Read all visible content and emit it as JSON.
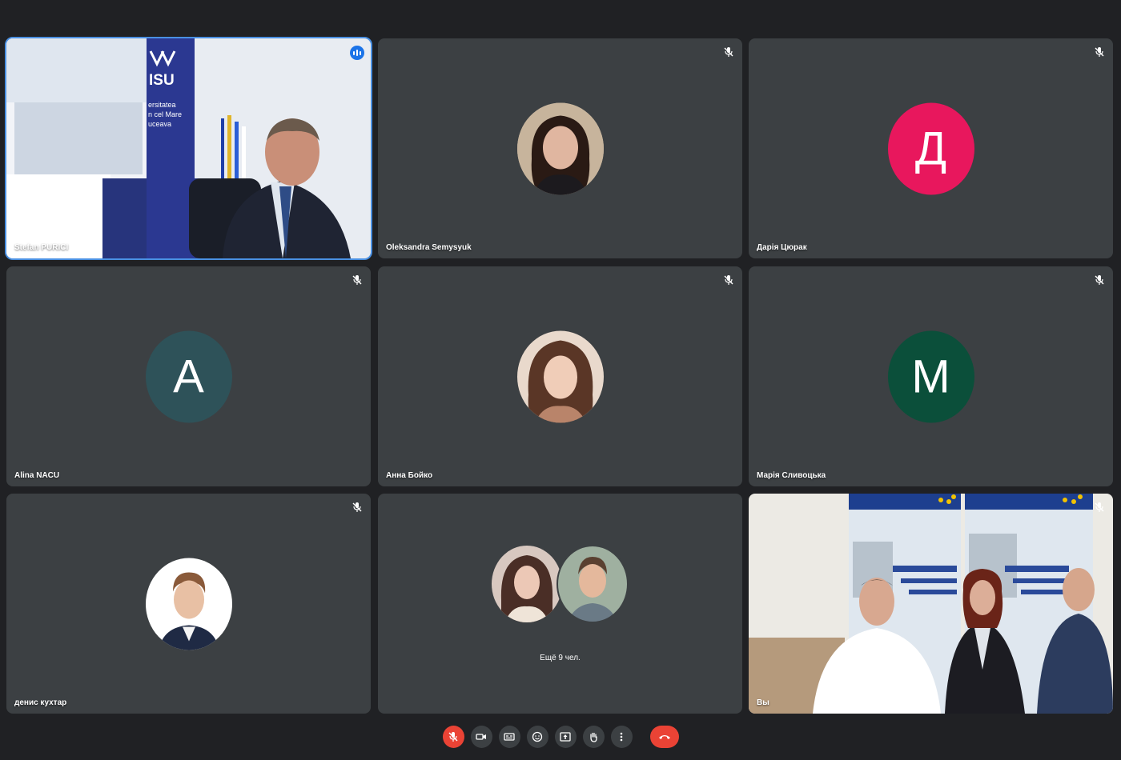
{
  "participants": [
    {
      "name": "Stefan PURICI",
      "kind": "video",
      "speaking": true
    },
    {
      "name": "Oleksandra Semysyuk",
      "kind": "photo",
      "muted": true
    },
    {
      "name": "Дарія Цюрак",
      "kind": "letter",
      "letter": "Д",
      "color": "#e8175d",
      "muted": true
    },
    {
      "name": "Alina NACU",
      "kind": "letter",
      "letter": "A",
      "color": "#2e5259",
      "muted": true
    },
    {
      "name": "Анна Бойко",
      "kind": "photo",
      "muted": true
    },
    {
      "name": "Марія Сливоцька",
      "kind": "letter",
      "letter": "M",
      "color": "#0b4f3a",
      "muted": true
    },
    {
      "name": "денис кухтар",
      "kind": "photo",
      "muted": true
    },
    {
      "more_label": "Ещё 9 чел."
    },
    {
      "name": "Вы",
      "kind": "video",
      "muted": true
    }
  ],
  "toolbar": {
    "icons": [
      "mic-off-icon",
      "camera-icon",
      "captions-icon",
      "emoji-icon",
      "present-icon",
      "raise-hand-icon",
      "more-icon",
      "hang-up-icon"
    ]
  },
  "colors": {
    "background": "#202124",
    "tile": "#3c4043",
    "accent": "#1a73e8",
    "danger": "#ea4335"
  }
}
